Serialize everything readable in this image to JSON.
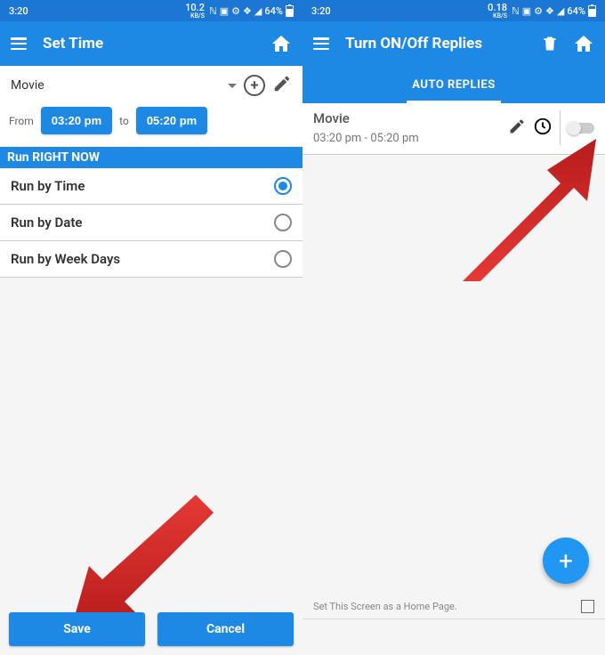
{
  "screen1": {
    "status": {
      "time": "3:20",
      "kbs": "10.2",
      "kbsunit": "KB/S",
      "battery": "64%"
    },
    "header": {
      "title": "Set Time"
    },
    "dropdown": {
      "value": "Movie"
    },
    "timeRow": {
      "from_label": "From",
      "from_value": "03:20 pm",
      "to_label": "to",
      "to_value": "05:20 pm"
    },
    "runBanner": "Run RIGHT NOW",
    "options": {
      "byTime": "Run by Time",
      "byDate": "Run by Date",
      "byWeek": "Run by Week Days"
    },
    "buttons": {
      "save": "Save",
      "cancel": "Cancel"
    }
  },
  "screen2": {
    "status": {
      "time": "3:20",
      "kbs": "0.18",
      "kbsunit": "KB/S",
      "battery": "64%"
    },
    "header": {
      "title": "Turn ON/Off Replies"
    },
    "tab": "AUTO REPLIES",
    "reply": {
      "title": "Movie",
      "timeRange": "03:20 pm - 05:20 pm"
    },
    "homePage": "Set This Screen as a Home Page."
  }
}
